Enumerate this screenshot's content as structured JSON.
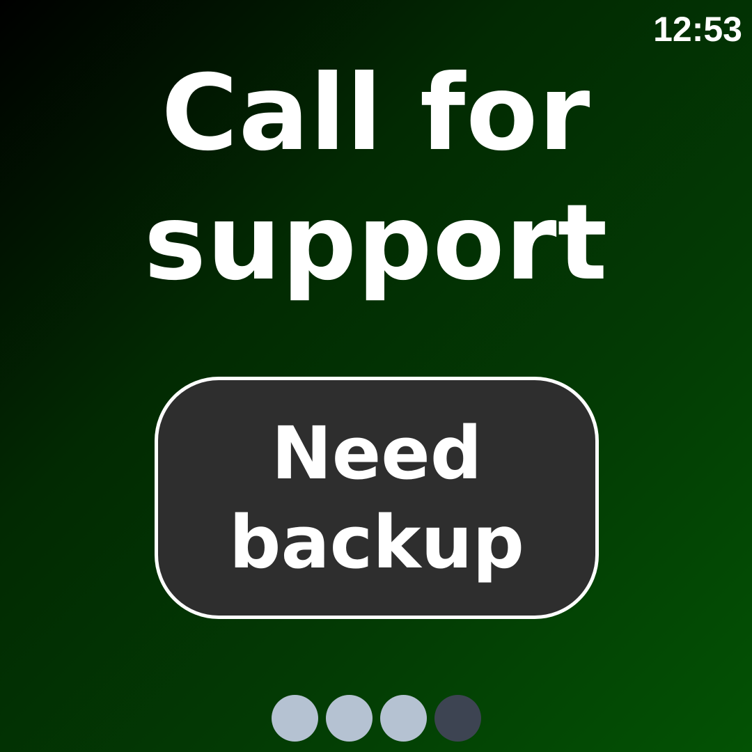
{
  "status_bar": {
    "time": "12:53"
  },
  "screen": {
    "title": "Call for support",
    "action_button": {
      "label": "Need backup"
    }
  },
  "pager": {
    "page_count": 4,
    "current_page": 4,
    "dots": [
      {
        "state": "inactive"
      },
      {
        "state": "inactive"
      },
      {
        "state": "inactive"
      },
      {
        "state": "active"
      }
    ]
  },
  "colors": {
    "background_start": "#000000",
    "background_end": "#035204",
    "button_fill": "#2e2e2e",
    "button_border": "#ffffff",
    "text": "#ffffff",
    "dot_inactive": "#b5c2d2",
    "dot_active": "#3d4452"
  }
}
